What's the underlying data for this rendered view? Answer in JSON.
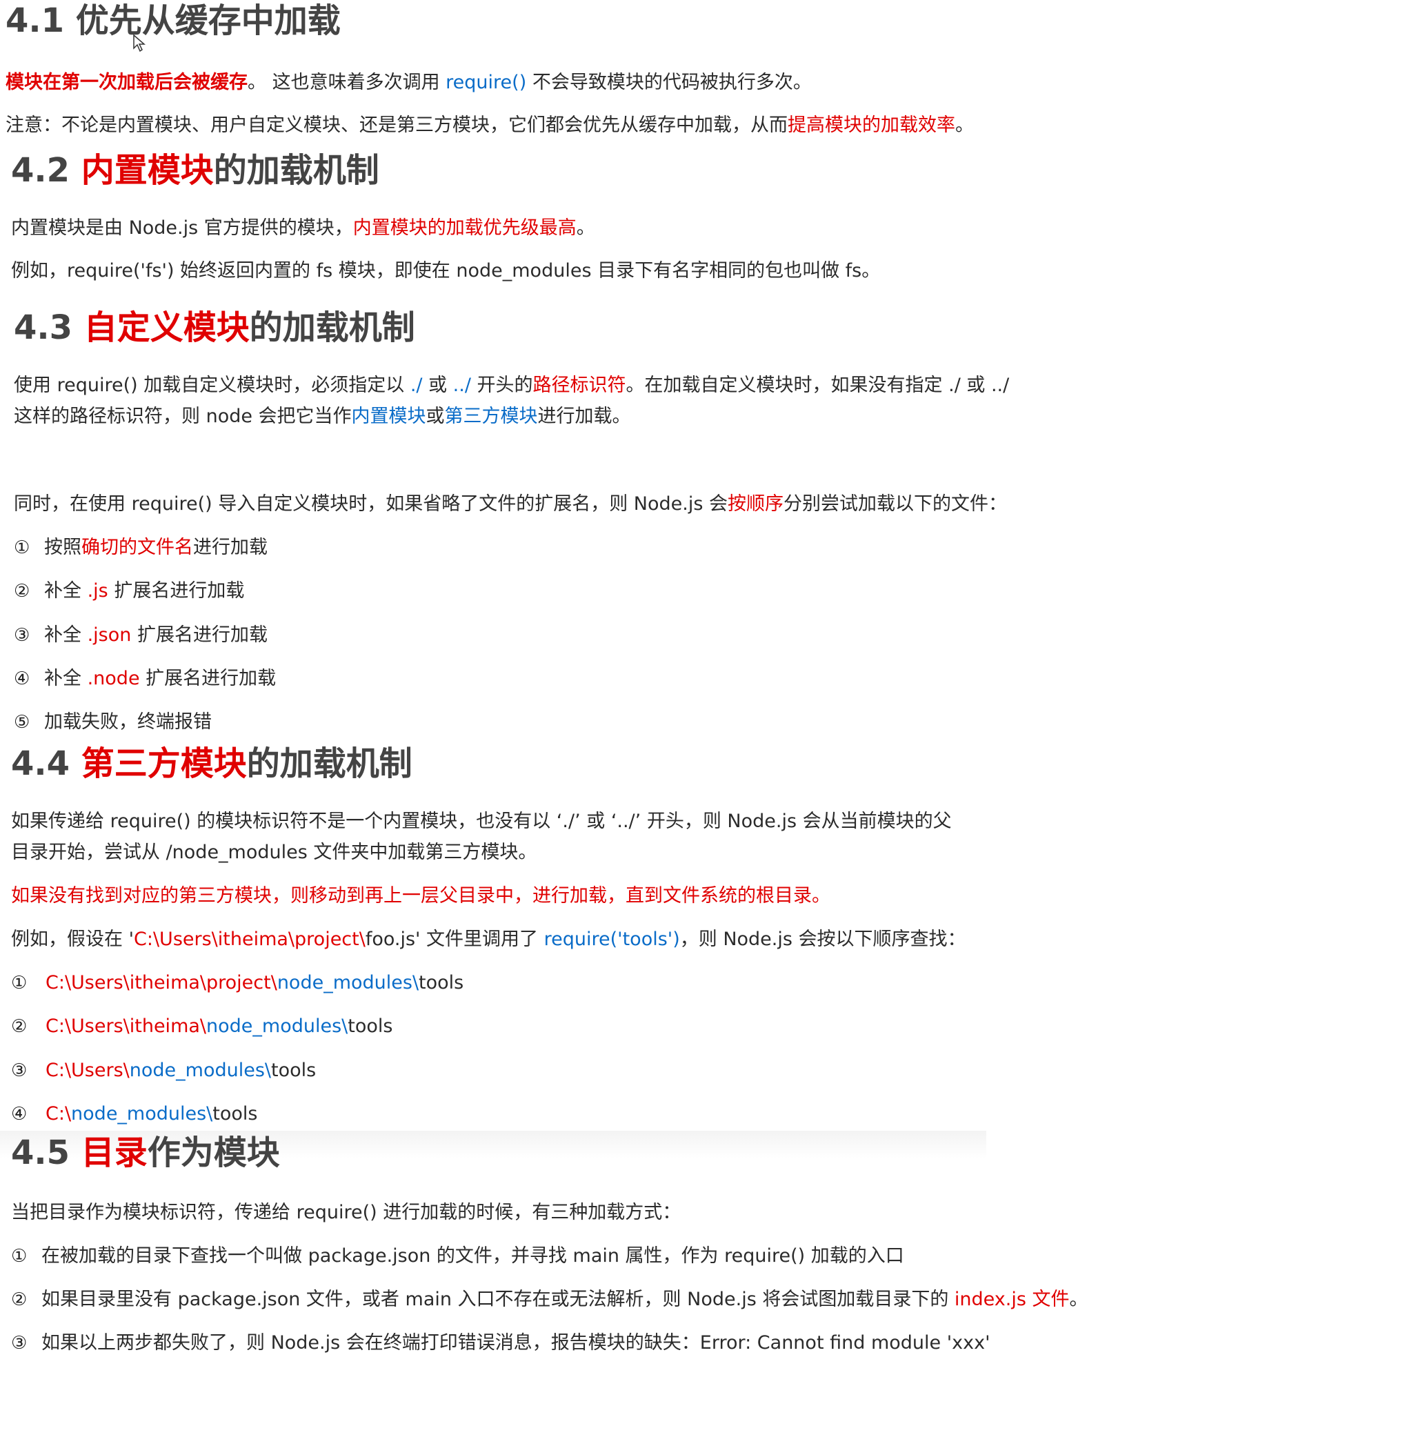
{
  "s1": {
    "title_num": "4.1",
    "title": "优先从缓存中加载",
    "p1_red": "模块在第一次加载后会被缓存",
    "p1_a": "。 这也意味着多次调用 ",
    "p1_code": "require()",
    "p1_b": " 不会导致模块的代码被执行多次。",
    "p2_a": "注意：不论是内置模块、用户自定义模块、还是第三方模块，它们都会优先从缓存中加载，从而",
    "p2_red": "提高模块的加载效率",
    "p2_b": "。"
  },
  "s2": {
    "title_num": "4.2",
    "title_red": "内置模块",
    "title_rest": "的加载机制",
    "p1_a": "内置模块是由 Node.js 官方提供的模块，",
    "p1_red": "内置模块的加载优先级最高",
    "p1_b": "。",
    "p2": "例如，require('fs') 始终返回内置的 fs 模块，即使在 node_modules 目录下有名字相同的包也叫做 fs。"
  },
  "s3": {
    "title_num": "4.3",
    "title_red": "自定义模块",
    "title_rest": "的加载机制",
    "p1_a": "使用 require() 加载自定义模块时，必须指定以 ",
    "p1_b1": "./",
    "p1_mid": " 或 ",
    "p1_b2": "../",
    "p1_c": " 开头的",
    "p1_red": "路径标识符",
    "p1_d": "。在加载自定义模块时，如果没有指定 ./ 或 ../",
    "p2_a": "这样的路径标识符，则 node 会把它当作",
    "p2_b1": "内置模块",
    "p2_or": "或",
    "p2_b2": "第三方模块",
    "p2_c": "进行加载。",
    "p3_a": "同时，在使用 require() 导入自定义模块时，如果省略了文件的扩展名，则 Node.js 会",
    "p3_red": "按顺序",
    "p3_b": "分别尝试加载以下的文件：",
    "items": [
      {
        "num": "①",
        "a": "按照",
        "red": "确切的文件名",
        "b": "进行加载"
      },
      {
        "num": "②",
        "a": "补全 ",
        "red": ".js",
        "b": " 扩展名进行加载"
      },
      {
        "num": "③",
        "a": "补全 ",
        "red": ".json",
        "b": " 扩展名进行加载"
      },
      {
        "num": "④",
        "a": "补全 ",
        "red": ".node",
        "b": " 扩展名进行加载"
      },
      {
        "num": "⑤",
        "a": "加载失败，终端报错",
        "red": "",
        "b": ""
      }
    ]
  },
  "s4": {
    "title_num": "4.4",
    "title_red": "第三方模块",
    "title_rest": "的加载机制",
    "p1": "如果传递给 require() 的模块标识符不是一个内置模块，也没有以 ‘./’ 或 ‘../’ 开头，则 Node.js 会从当前模块的父",
    "p2": "目录开始，尝试从 /node_modules 文件夹中加载第三方模块。",
    "p3_red": "如果没有找到对应的第三方模块，则移动到再上一层父目录中，进行加载，直到文件系统的根目录。",
    "p4_a": "例如，假设在 '",
    "p4_red": "C:\\Users\\itheima\\project\\",
    "p4_b": "foo.js' 文件里调用了 ",
    "p4_code": "require('tools')",
    "p4_c": "，则 Node.js 会按以下顺序查找：",
    "paths": [
      {
        "num": "①",
        "red": "C:\\Users\\itheima\\project\\",
        "blue": "node_modules\\",
        "end": "tools"
      },
      {
        "num": "②",
        "red": "C:\\Users\\itheima\\",
        "blue": "node_modules\\",
        "end": "tools"
      },
      {
        "num": "③",
        "red": "C:\\Users\\",
        "blue": "node_modules\\",
        "end": "tools"
      },
      {
        "num": "④",
        "red": "C:\\",
        "blue": "node_modules\\",
        "end": "tools"
      }
    ]
  },
  "s5": {
    "title_num": "4.5",
    "title_red": "目录",
    "title_rest": "作为模块",
    "p1": "当把目录作为模块标识符，传递给 require() 进行加载的时候，有三种加载方式：",
    "i1_num": "①",
    "i1": "在被加载的目录下查找一个叫做 package.json 的文件，并寻找 main 属性，作为 require() 加载的入口",
    "i2_num": "②",
    "i2_a": "如果目录里没有 package.json 文件，或者 main 入口不存在或无法解析，则 Node.js 将会试图加载目录下的 ",
    "i2_red": "index.js 文件",
    "i2_b": "。",
    "i3_num": "③",
    "i3": "如果以上两步都失败了，则 Node.js 会在终端打印错误消息，报告模块的缺失：Error: Cannot find module 'xxx'"
  },
  "colors": {
    "red": "#e00000",
    "blue": "#0a6cc8",
    "heading": "#444444",
    "text": "#2b2b2b"
  }
}
